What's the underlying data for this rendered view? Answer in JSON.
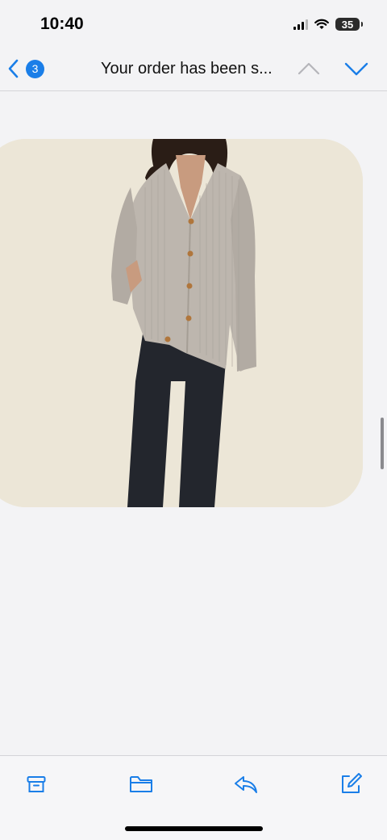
{
  "status_bar": {
    "time": "10:40",
    "battery": "35",
    "icons": [
      "signal-icon",
      "wifi-icon",
      "battery-icon"
    ]
  },
  "nav": {
    "back_icon": "chevron-left-icon",
    "unread_count": "3",
    "title": "Your order has been s...",
    "up_icon": "chevron-up-icon",
    "down_icon": "chevron-down-icon",
    "up_enabled": false,
    "accent_color": "#1a7ee8"
  },
  "content": {
    "product_image": {
      "subject": "model wearing grey ribbed v-neck cardigan with dark trousers",
      "background_color": "#ece6d7"
    }
  },
  "toolbar": {
    "items": [
      {
        "icon": "archive-icon"
      },
      {
        "icon": "folder-icon"
      },
      {
        "icon": "reply-icon"
      },
      {
        "icon": "compose-icon"
      }
    ]
  }
}
